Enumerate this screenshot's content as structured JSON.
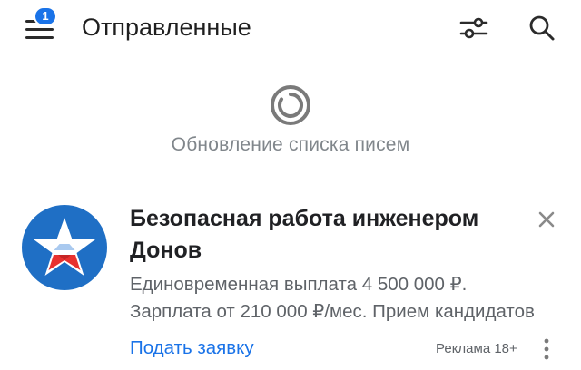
{
  "header": {
    "title": "Отправленные",
    "menu_badge": "1",
    "menu_icon": "menu-icon",
    "filter_icon": "filter-sliders-icon",
    "search_icon": "search-icon"
  },
  "refresh": {
    "status_text": "Обновление списка писем",
    "icon": "refresh-spinner-icon"
  },
  "ad": {
    "title": "Безопасная работа инженером Донов",
    "body_line1": "Единовременная выплата 4 500 000 ₽.",
    "body_line2": "Зарплата от 210 000 ₽/мес. Прием кандидатов",
    "apply_label": "Подать заявку",
    "ad_label": "Реклама 18+",
    "avatar_icon": "star-logo-icon",
    "close_icon": "close-icon",
    "more_icon": "more-vertical-icon"
  },
  "colors": {
    "accent": "#1a73e8",
    "text_primary": "#1f1f1f",
    "text_secondary": "#5f6368",
    "muted": "#80868b",
    "avatar_bg": "#1f6fc5",
    "star_red": "#e8312f"
  }
}
